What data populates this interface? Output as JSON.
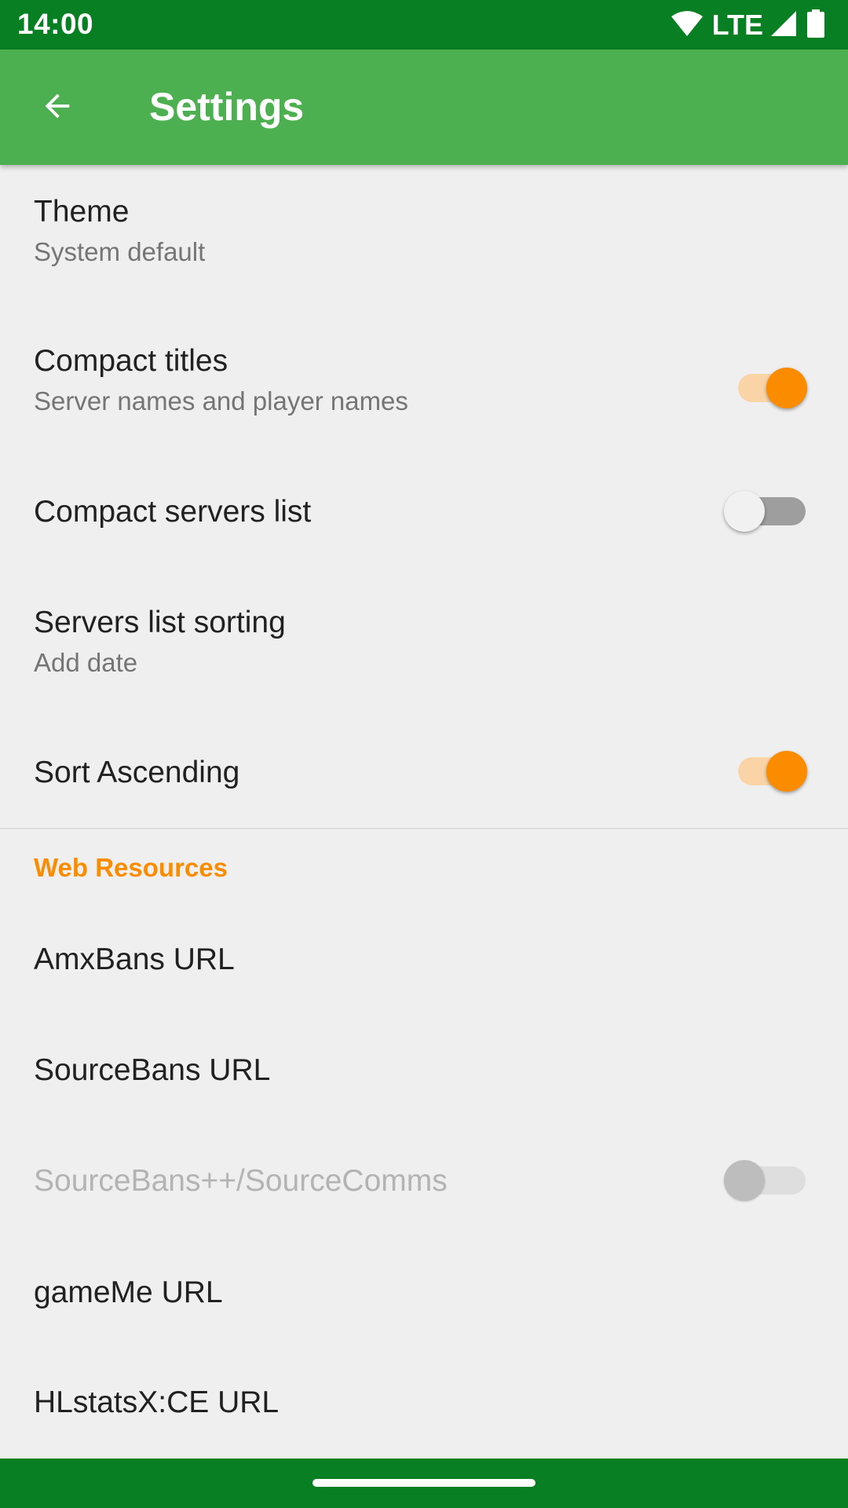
{
  "status_bar": {
    "time": "14:00",
    "network": "LTE",
    "icons": [
      "wifi-icon",
      "signal-icon",
      "battery-icon"
    ]
  },
  "app_bar": {
    "title": "Settings",
    "back_icon": "arrow-back-icon"
  },
  "colors": {
    "status_bar": "#087f23",
    "app_bar": "#4caf50",
    "accent": "#fb8c00",
    "background": "#efefef"
  },
  "preferences": [
    {
      "title": "Theme",
      "summary": "System default"
    },
    {
      "title": "Compact titles",
      "summary": "Server names and player names",
      "switch": "on"
    },
    {
      "title": "Compact servers list",
      "switch": "off"
    },
    {
      "title": "Servers list sorting",
      "summary": "Add date"
    },
    {
      "title": "Sort Ascending",
      "switch": "on"
    }
  ],
  "web_resources": {
    "category_title": "Web Resources",
    "items": [
      {
        "title": "AmxBans URL"
      },
      {
        "title": "SourceBans URL"
      },
      {
        "title": "SourceBans++/SourceComms",
        "switch": "off",
        "disabled": true
      },
      {
        "title": "gameMe URL"
      },
      {
        "title": "HLstatsX:CE URL"
      }
    ]
  }
}
